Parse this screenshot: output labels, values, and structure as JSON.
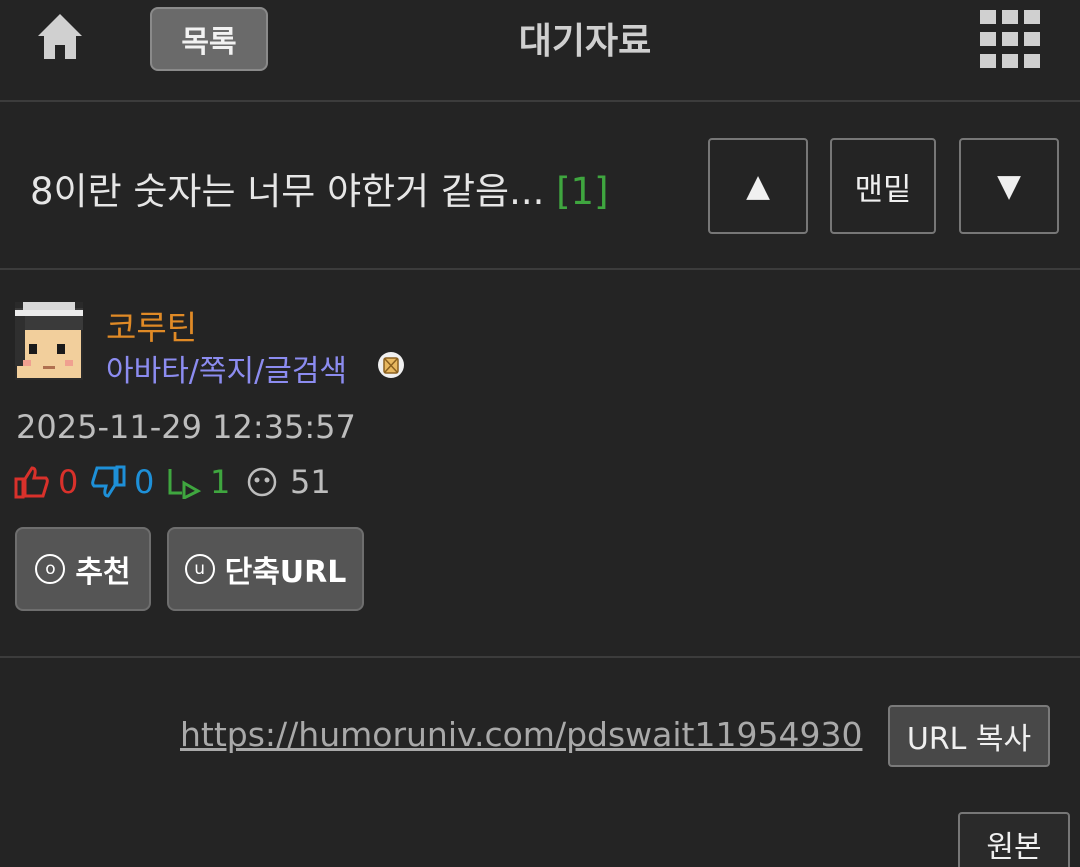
{
  "header": {
    "home_icon": "home-icon",
    "list_label": "목록",
    "title": "대기자료",
    "menu_icon": "grid-icon"
  },
  "post": {
    "title": "8이란 숫자는 너무 야한거 같음...",
    "comment_count": "[1]",
    "nav": {
      "up_label": "▲",
      "bottom_label": "맨밑",
      "down_label": "▼"
    }
  },
  "author": {
    "name": "코루틴",
    "links": "아바타/쪽지/글검색",
    "name_color": "#e08a26",
    "links_color": "#8c8cf0"
  },
  "meta": {
    "date": "2025-11-29 12:35:57",
    "likes": "0",
    "dislikes": "0",
    "replies": "1",
    "views": "51",
    "colors": {
      "likes": "#d9312b",
      "dislikes": "#1e90d8",
      "replies": "#3fa63f",
      "views": "#bdbdbd"
    }
  },
  "actions": {
    "recommend_key": "o",
    "recommend_label": "추천",
    "shorturl_key": "u",
    "shorturl_label": "단축URL"
  },
  "share": {
    "url": "https://humoruniv.com/pdswait11954930",
    "copy_label": "URL 복사",
    "original_label": "원본"
  }
}
